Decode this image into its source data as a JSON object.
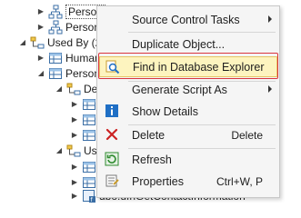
{
  "tree": {
    "rows": [
      {
        "label": "Person",
        "selected": true
      },
      {
        "label": "Person"
      },
      {
        "label": "Used By (2"
      },
      {
        "label": "Human"
      },
      {
        "label": "Person"
      },
      {
        "label": "Dep"
      },
      {
        "label": ""
      },
      {
        "label": ""
      },
      {
        "label": ""
      },
      {
        "label": "Use"
      },
      {
        "label": ""
      },
      {
        "label": ""
      },
      {
        "label": "dbo.ufnGetContactInformation"
      }
    ]
  },
  "menu": {
    "items": [
      {
        "label": "Source Control Tasks",
        "shortcut": "",
        "submenu": true,
        "icon": "none"
      },
      {
        "label": "Duplicate Object...",
        "shortcut": "",
        "submenu": false,
        "icon": "none"
      },
      {
        "label": "Find in Database Explorer",
        "shortcut": "",
        "submenu": false,
        "icon": "find-database-icon",
        "highlighted": true
      },
      {
        "label": "Generate Script As",
        "shortcut": "",
        "submenu": true,
        "icon": "none"
      },
      {
        "label": "Show Details",
        "shortcut": "",
        "submenu": false,
        "icon": "info-icon"
      },
      {
        "label": "Delete",
        "shortcut": "Delete",
        "submenu": false,
        "icon": "delete-x-icon"
      },
      {
        "label": "Refresh",
        "shortcut": "",
        "submenu": false,
        "icon": "refresh-icon"
      },
      {
        "label": "Properties",
        "shortcut": "Ctrl+W, P",
        "submenu": false,
        "icon": "properties-icon"
      }
    ]
  },
  "colors": {
    "highlight_bg": "#fdf4bf",
    "highlight_border": "#e5c365",
    "callout_red": "#d9363e",
    "delete_red": "#cc2222",
    "info_blue": "#1f6fc5",
    "refresh_green": "#2e8b2e"
  }
}
